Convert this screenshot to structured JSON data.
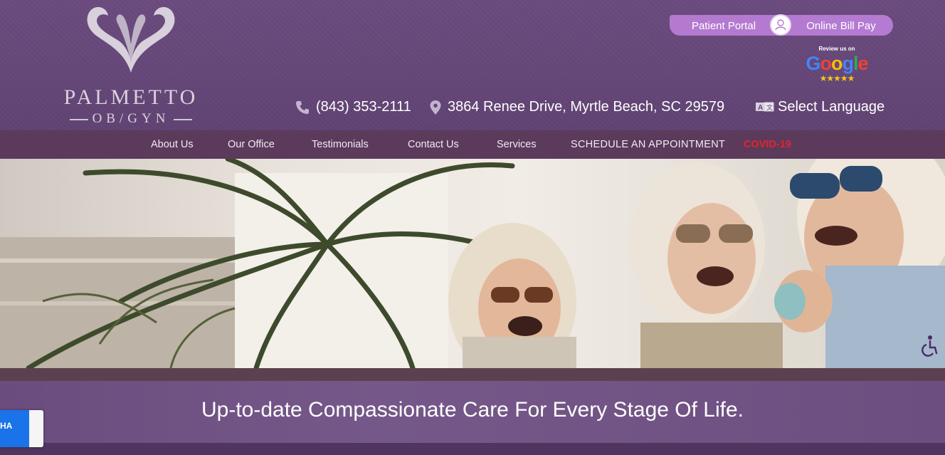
{
  "logo": {
    "name": "PALMETTO",
    "sub": "OB/GYN"
  },
  "top_links": {
    "patient_portal": "Patient Portal",
    "online_bill_pay": "Online Bill Pay"
  },
  "google_badge": {
    "review_text": "Review us on",
    "brand": "Google",
    "stars": "★★★★★"
  },
  "contact": {
    "phone": "(843) 353-2111",
    "address": "3864 Renee Drive, Myrtle Beach, SC 29579",
    "language": "Select Language"
  },
  "nav": {
    "items": [
      "About Us",
      "Our Office",
      "Testimonials",
      "Contact Us",
      "Services",
      "SCHEDULE AN APPOINTMENT",
      "COVID-19"
    ]
  },
  "hero": {
    "tagline": "Up-to-date Compassionate Care For Every Stage Of Life."
  },
  "recaptcha": {
    "text": "HA"
  },
  "colors": {
    "header_bg": "#63457a",
    "nav_bg": "#5b3a5c",
    "portal_bar": "#b57bd2",
    "covid_red": "#e3242b"
  }
}
